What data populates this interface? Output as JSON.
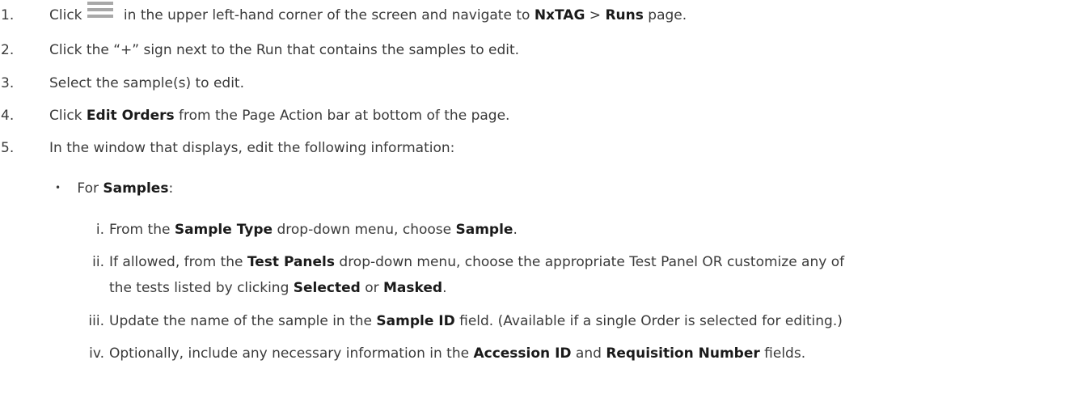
{
  "steps": [
    {
      "num": "1.",
      "t1": "Click",
      "t2": " in the upper left-hand corner of the screen and navigate to ",
      "b1": "NxTAG",
      "t3": " > ",
      "b2": "Runs",
      "t4": " page."
    },
    {
      "num": "2.",
      "text": "Click the “+” sign next to the Run that contains the samples to edit."
    },
    {
      "num": "3.",
      "text": "Select the sample(s) to edit."
    },
    {
      "num": "4.",
      "t1": "Click ",
      "b1": "Edit Orders",
      "t2": " from the Page Action bar at bottom of the page."
    },
    {
      "num": "5.",
      "text": "In the window that displays, edit the following information:"
    }
  ],
  "bullet": {
    "dot": "•",
    "t1": "For ",
    "b1": "Samples",
    "t2": ":"
  },
  "substeps": [
    {
      "num": "i.",
      "t1": "From the ",
      "b1": "Sample Type",
      "t2": " drop-down menu, choose ",
      "b2": "Sample",
      "t3": "."
    },
    {
      "num": "ii.",
      "t1": "If allowed, from the ",
      "b1": "Test Panels",
      "t2": " drop-down menu, choose the appropriate Test Panel OR customize any of",
      "c1": "the tests listed by clicking ",
      "cb1": "Selected",
      "c2": " or ",
      "cb2": "Masked",
      "c3": "."
    },
    {
      "num": "iii.",
      "t1": "Update the name of the sample in the ",
      "b1": "Sample ID",
      "t2": " field. (Available if a single Order is selected for editing.)"
    },
    {
      "num": "iv.",
      "t1": "Optionally, include any necessary information in the ",
      "b1": "Accession ID",
      "t2": " and ",
      "b2": "Requisition Number",
      "t3": " fields."
    }
  ]
}
